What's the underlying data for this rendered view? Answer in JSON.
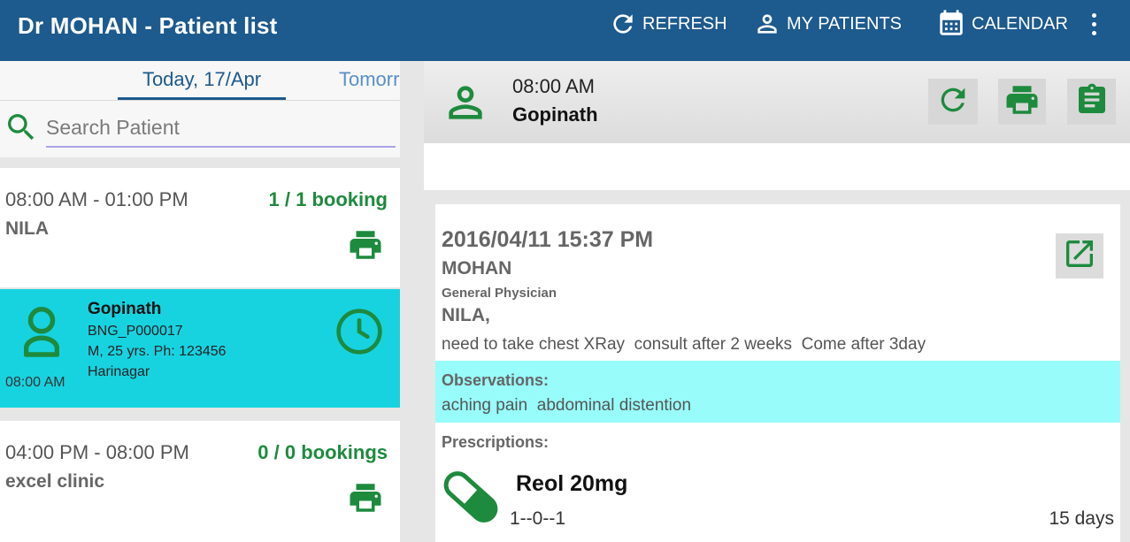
{
  "appbar": {
    "title": "Dr MOHAN - Patient list",
    "refresh_label": "REFRESH",
    "my_patients_label": "MY PATIENTS",
    "calendar_label": "CALENDAR",
    "color": "#1d5a8e"
  },
  "left": {
    "tabs": [
      {
        "label": "Today, 17/Apr",
        "selected": true
      },
      {
        "label": "Tomorr",
        "selected": false
      }
    ],
    "search": {
      "placeholder": "Search Patient",
      "value": ""
    },
    "slots": [
      {
        "time": "08:00 AM - 01:00 PM",
        "clinic": "NILA",
        "bookings": "1 / 1 booking"
      },
      {
        "time": "04:00 PM - 08:00 PM",
        "clinic": "excel clinic",
        "bookings": "0 / 0 bookings"
      }
    ],
    "patient": {
      "name": "Gopinath",
      "id": "BNG_P000017",
      "details": "M, 25 yrs. Ph: 123456",
      "area": "Harinagar",
      "time": "08:00 AM",
      "color": "#17d3e0"
    }
  },
  "right": {
    "header": {
      "time": "08:00 AM",
      "name": "Gopinath"
    },
    "visit": {
      "datetime": "2016/04/11 15:37 PM",
      "doctor": "MOHAN",
      "speciality": "General Physician",
      "clinic": "NILA,",
      "notes": "need to take chest XRay  consult after 2 weeks  Come after 3day",
      "observations_label": "Observations:",
      "observations": "aching pain  abdominal distention",
      "observations_color": "#97fcfa",
      "prescriptions_label": "Prescriptions:",
      "prescriptions": [
        {
          "drug": "Reol 20mg",
          "dosage": "1--0--1",
          "duration": "15 days"
        }
      ]
    }
  },
  "icons": {
    "accent": "#1e8a3e",
    "names": [
      "refresh-icon",
      "person-icon",
      "calendar-icon",
      "overflow-menu-icon",
      "search-icon",
      "print-icon",
      "clock-icon",
      "clipboard-icon",
      "open-external-icon",
      "pill-icon"
    ]
  }
}
